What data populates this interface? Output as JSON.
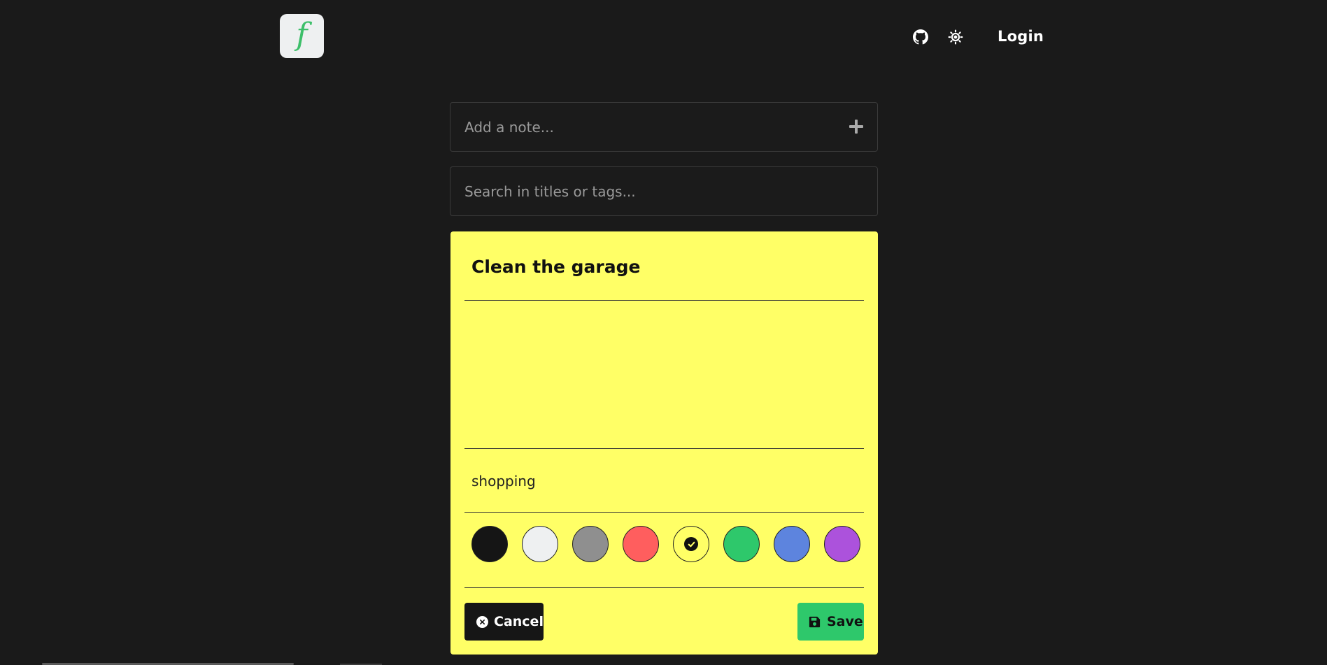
{
  "header": {
    "logo_letter": "f",
    "login_label": "Login",
    "icons": [
      "github-icon",
      "sun-icon"
    ]
  },
  "add_note": {
    "placeholder": "Add a note..."
  },
  "search": {
    "placeholder": "Search in titles or tags..."
  },
  "note": {
    "title": "Clean the garage",
    "body": "",
    "tags": "shopping",
    "colors": [
      {
        "name": "black",
        "hex": "#151515",
        "selected": false
      },
      {
        "name": "white",
        "hex": "#eef0f1",
        "selected": false
      },
      {
        "name": "gray",
        "hex": "#8f8f8f",
        "selected": false
      },
      {
        "name": "red",
        "hex": "#ff5e5e",
        "selected": false
      },
      {
        "name": "yellow",
        "hex": "#ffff66",
        "selected": true
      },
      {
        "name": "green",
        "hex": "#2ec86b",
        "selected": false
      },
      {
        "name": "blue",
        "hex": "#5d84de",
        "selected": false
      },
      {
        "name": "purple",
        "hex": "#ac52dc",
        "selected": false
      }
    ],
    "background": "#ffff66",
    "cancel_label": "Cancel",
    "save_label": "Save"
  }
}
